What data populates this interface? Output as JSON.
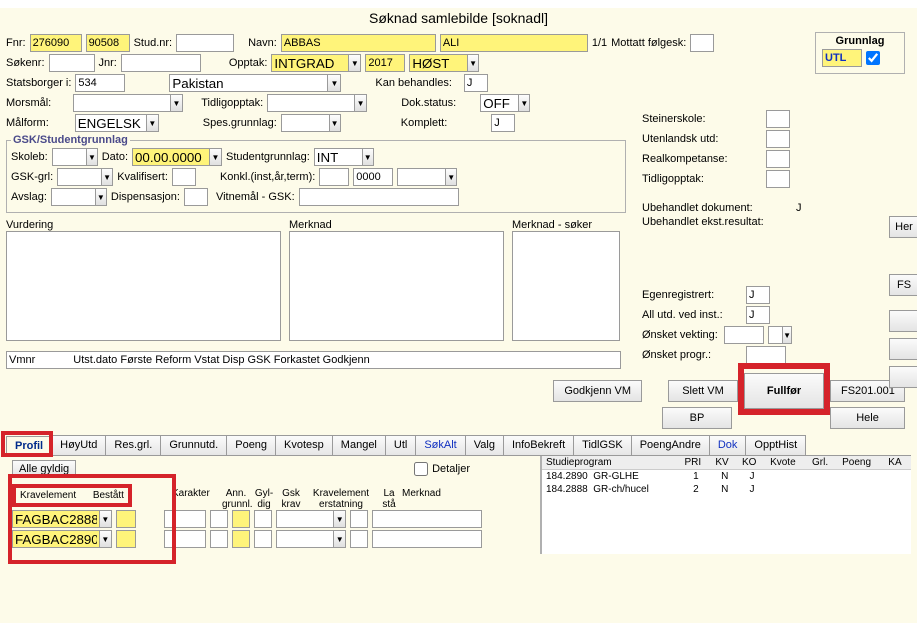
{
  "window_title": "Søknad samlebilde  [soknadl]",
  "grunnlag": {
    "label": "Grunnlag",
    "code": "UTL"
  },
  "header": {
    "fnr_lbl": "Fnr:",
    "fnr1": "276090",
    "fnr2": "90508",
    "studnr_lbl": "Stud.nr:",
    "studnr": "",
    "navn_lbl": "Navn:",
    "navn1": "ABBAS",
    "navn2": "ALI",
    "pos": "1/1",
    "mottatt_lbl": "Mottatt følgesk:",
    "sokenr_lbl": "Søkenr:",
    "jnr_lbl": "Jnr:",
    "opptak_lbl": "Opptak:",
    "opptak": "INTGRAD",
    "year": "2017",
    "sem": "HØST",
    "statsborger_lbl": "Statsborger i:",
    "statsborger_code": "534",
    "statsborger_name": "Pakistan",
    "kan_lbl": "Kan behandles:",
    "kan_val": "J",
    "morsmal_lbl": "Morsmål:",
    "tidlig_lbl": "Tidligopptak:",
    "dokstatus_lbl": "Dok.status:",
    "dokstatus_val": "OFF",
    "malform_lbl": "Målform:",
    "malform_val": "ENGELSK",
    "spes_lbl": "Spes.grunnlag:",
    "komplett_lbl": "Komplett:",
    "komplett_val": "J"
  },
  "gsk": {
    "legend": "GSK/Studentgrunnlag",
    "skoleb_lbl": "Skoleb:",
    "dato_lbl": "Dato:",
    "dato_val": "00.00.0000",
    "studentgrunnlag_lbl": "Studentgrunnlag:",
    "studentgrunnlag_val": "INT",
    "gskgrl_lbl": "GSK-grl:",
    "kvalifisert_lbl": "Kvalifisert:",
    "konkl_lbl": "Konkl.(inst,år,term):",
    "konkl_year": "0000",
    "avslag_lbl": "Avslag:",
    "dispensasjon_lbl": "Dispensasjon:",
    "vitnemal_lbl": "Vitnemål - GSK:"
  },
  "right_col": {
    "steinerskole_lbl": "Steinerskole:",
    "utenlandsk_lbl": "Utenlandsk utd:",
    "realkompetanse_lbl": "Realkompetanse:",
    "tidligopptak2_lbl": "Tidligopptak:",
    "ubeh_dok_lbl": "Ubehandlet dokument:",
    "ubeh_dok_val": "J",
    "ubeh_ekst_lbl": "Ubehandlet ekst.resultat:"
  },
  "text_areas": {
    "vurdering_lbl": "Vurdering",
    "merknad_lbl": "Merknad",
    "merknad_soker_lbl": "Merknad - søker"
  },
  "mid_right": {
    "egen_lbl": "Egenregistrert:",
    "egen_val": "J",
    "allutd_lbl": "All utd. ved inst.:",
    "allutd_val": "J",
    "vekting_lbl": "Ønsket vekting:",
    "progr_lbl": "Ønsket progr.:"
  },
  "vmnr": {
    "label": "Vmnr",
    "cols": "Utst.dato Første Reform Vstat Disp GSK Forkastet Godkjenn"
  },
  "buttons": {
    "godkjenn_vm": "Godkjenn VM",
    "slett_vm": "Slett VM",
    "bp": "BP",
    "fullfor": "Fullfør",
    "fs201": "FS201.001",
    "hele": "Hele",
    "her": "Her",
    "fs": "FS",
    "alle_gyldig": "Alle gyldig"
  },
  "tabs": [
    "Profil",
    "HøyUtd",
    "Res.grl.",
    "Grunnutd.",
    "Poeng",
    "Kvotesp",
    "Mangel",
    "Utl",
    "SøkAlt",
    "Valg",
    "InfoBekreft",
    "TidlGSK",
    "PoengAndre",
    "Dok",
    "OpptHist"
  ],
  "lower": {
    "detaljer_lbl": "Detaljer",
    "kravelement_lbl": "Kravelement",
    "bestatt_lbl": "Bestått",
    "cols": {
      "karakter": "Karakter",
      "ann": "Ann.",
      "gyl": "Gyl-",
      "grunnl": "grunnl.",
      "dig": "dig",
      "gsk": "Gsk",
      "krav": "krav",
      "kravelement2": "Kravelement",
      "erstatning": "erstatning",
      "la": "La",
      "sta": "stå",
      "merknad": "Merknad"
    },
    "rows": [
      {
        "code": "FAGBAC2888"
      },
      {
        "code": "FAGBAC2890"
      }
    ]
  },
  "programs": {
    "headers": [
      "Studieprogram",
      "PRI",
      "KV",
      "KO",
      "Kvote",
      "Grl.",
      "Poeng",
      "KA"
    ],
    "rows": [
      {
        "code": "184.2890",
        "name": "GR-GLHE",
        "pri": "1",
        "kv": "N",
        "ko": "J"
      },
      {
        "code": "184.2888",
        "name": "GR-ch/hucel",
        "pri": "2",
        "kv": "N",
        "ko": "J"
      }
    ]
  }
}
